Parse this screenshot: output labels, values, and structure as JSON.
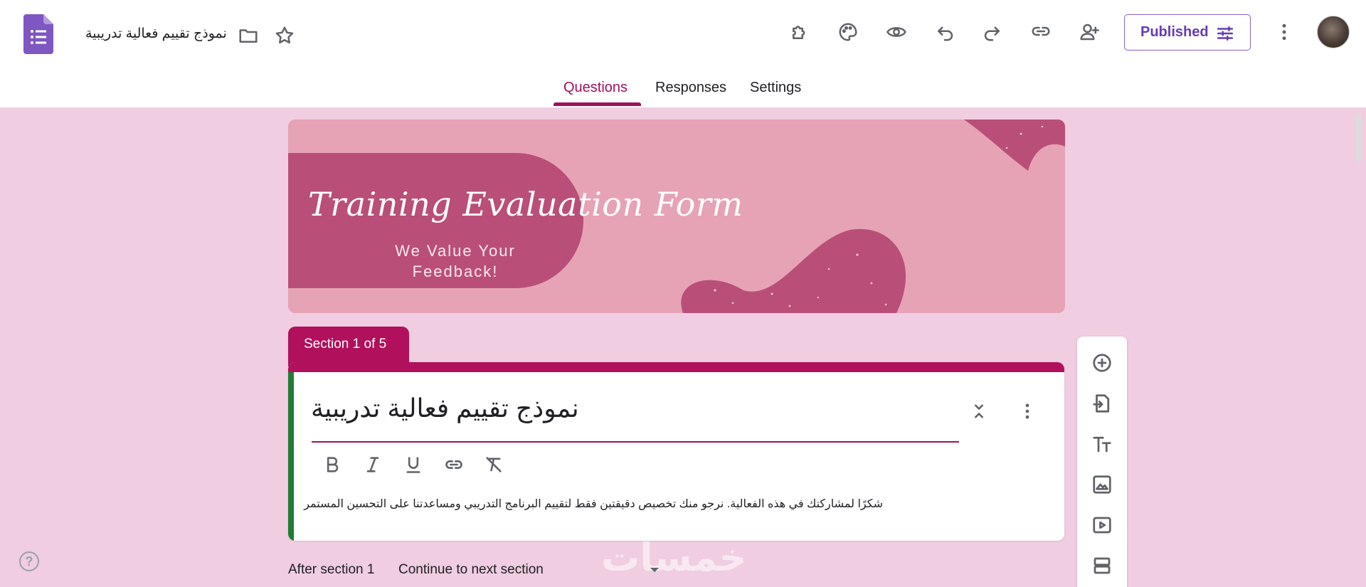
{
  "header": {
    "doc_title": "نموذج تقييم فعالية تدريبية",
    "published_label": "Published",
    "icons": [
      "forms-logo-icon",
      "folder-icon",
      "star-icon",
      "addon-icon",
      "palette-icon",
      "preview-eye-icon",
      "undo-icon",
      "redo-icon",
      "link-icon",
      "add-collaborator-icon",
      "publish-settings-icon",
      "more-vert-icon"
    ]
  },
  "tabs": [
    {
      "label": "Questions",
      "active": true
    },
    {
      "label": "Responses",
      "active": false
    },
    {
      "label": "Settings",
      "active": false
    }
  ],
  "banner": {
    "title": "Training Evaluation Form",
    "subtitle": "We Value Your Feedback!"
  },
  "section": {
    "tab_label": "Section 1 of 5",
    "title": "نموذج تقييم فعالية تدريبية",
    "description": "شكرًا لمشاركتك في هذه الفعالية. نرجو منك تخصيص دقيقتين فقط لتقييم البرنامج التدريبي ومساعدتنا على التحسين المستمر",
    "after_label": "After section 1",
    "after_value": "Continue to next section"
  },
  "watermark": "خمسات",
  "help_label": "?",
  "colors": {
    "accent": "#a0105a",
    "section_tab": "#b0105c",
    "page_bg": "#f0cde0",
    "banner_bg": "#e6a3b5",
    "banner_shape": "#b94f78",
    "left_rule": "#1e7d32",
    "publish_purple": "#673ab7"
  }
}
